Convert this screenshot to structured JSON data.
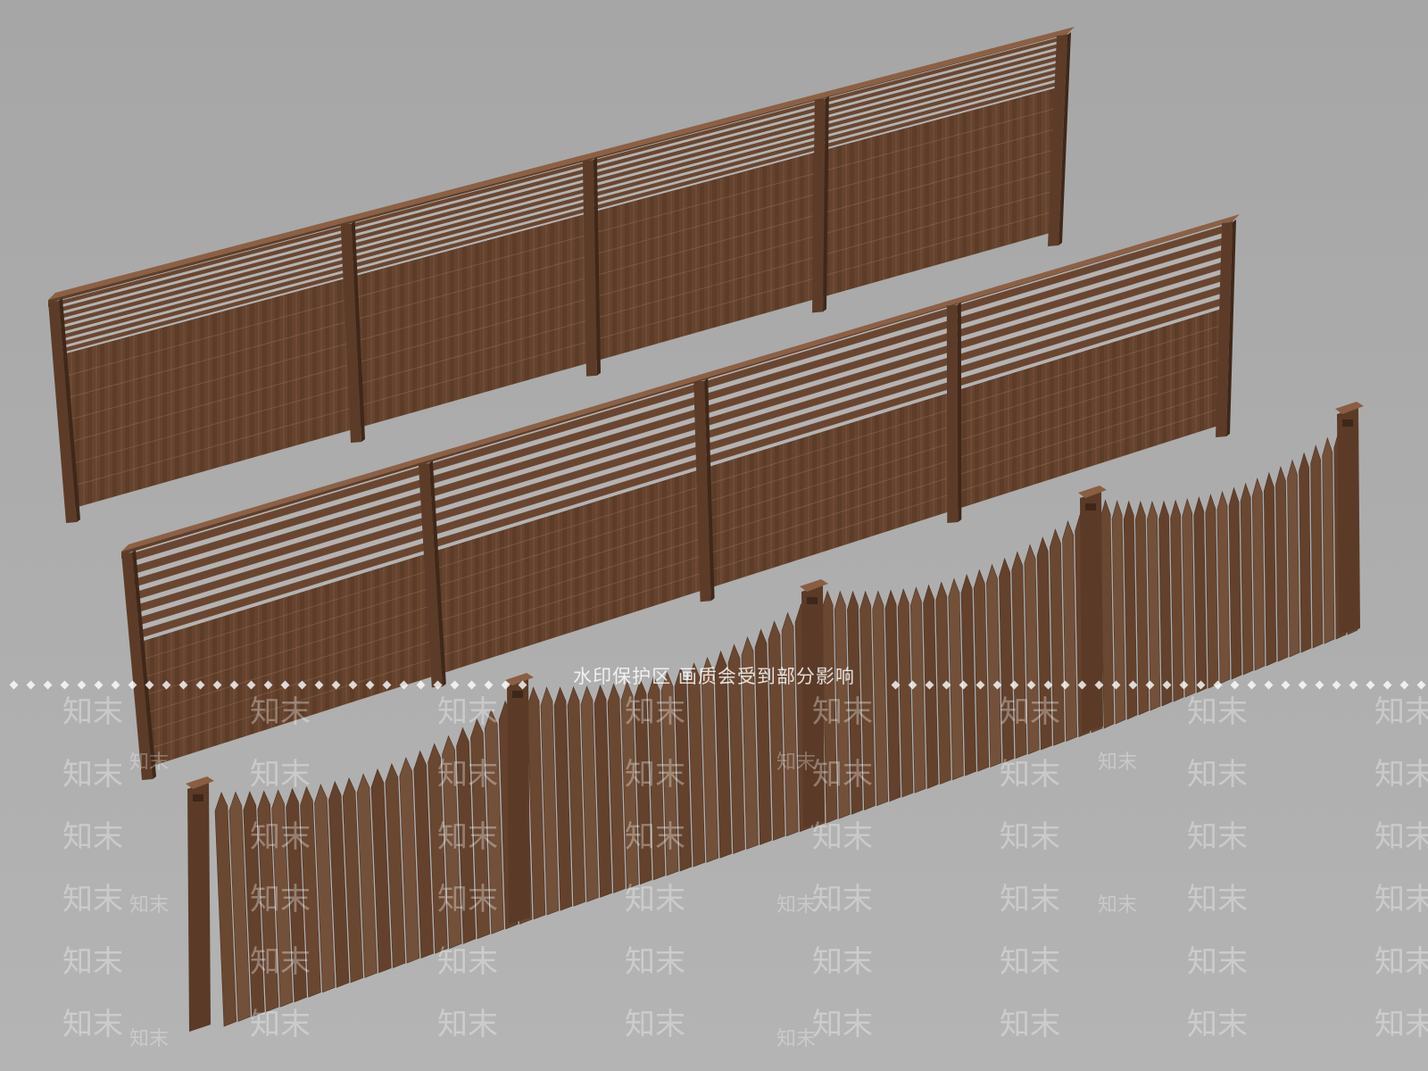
{
  "scene": {
    "background_color": "#a9a9a9",
    "wood_color": "#6e4b34",
    "wood_dark_color": "#4f3322",
    "wood_light_color": "#8a5f43",
    "rail_gap_color": "#b3b3b3",
    "fences": [
      {
        "name": "slatted-top-fence-back",
        "style": "horizontal-slat-top",
        "slat_count": 8
      },
      {
        "name": "slatted-top-fence-middle",
        "style": "horizontal-slat-top",
        "slat_count": 7
      },
      {
        "name": "picket-fence-front",
        "style": "pointed-picket"
      }
    ]
  },
  "watermark": {
    "notice": "水印保护区 画质会受到部分影响",
    "brand": "知末"
  }
}
